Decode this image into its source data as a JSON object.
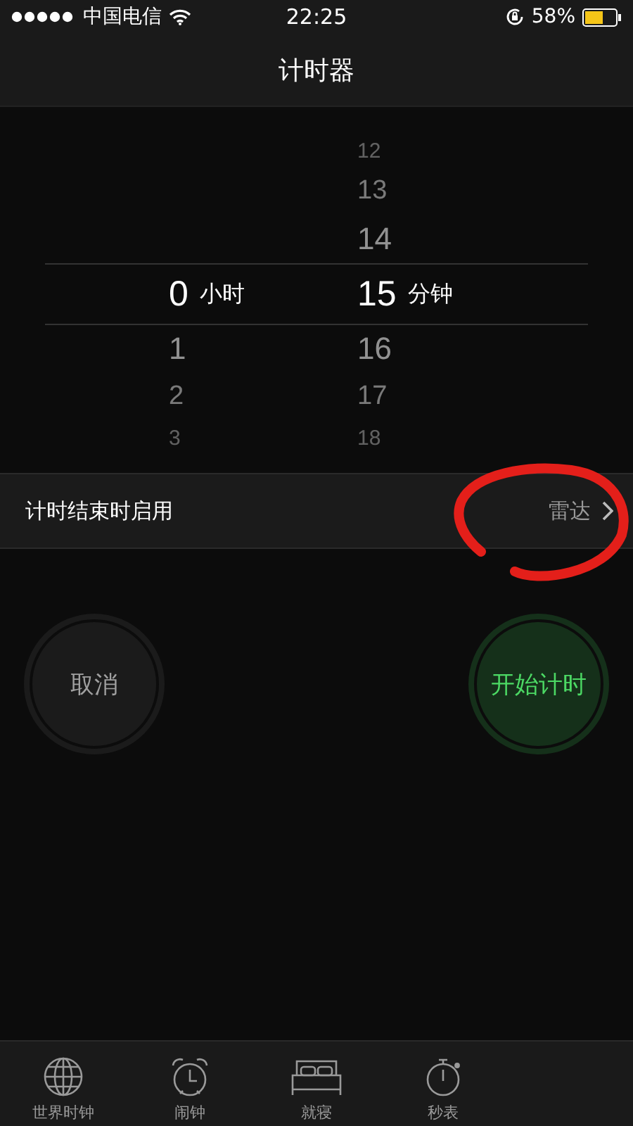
{
  "status_bar": {
    "carrier": "中国电信",
    "time": "22:25",
    "battery": "58%"
  },
  "nav": {
    "title": "计时器"
  },
  "picker": {
    "columns": [
      {
        "selected": "0",
        "below": [
          "1",
          "2",
          "3"
        ],
        "unit": "小时"
      },
      {
        "above": [
          "12",
          "13",
          "14"
        ],
        "selected": "15",
        "below": [
          "16",
          "17",
          "18"
        ],
        "unit": "分钟"
      }
    ]
  },
  "setting": {
    "label": "计时结束时启用",
    "value": "雷达"
  },
  "buttons": [
    {
      "label": "取消",
      "kind": "cancel"
    },
    {
      "label": "开始计时",
      "kind": "start"
    }
  ],
  "annotation": {
    "kind": "circle"
  },
  "tabs": [
    {
      "label": "世界时钟",
      "kind": "globe",
      "selected": false
    },
    {
      "label": "闹钟",
      "kind": "alarm",
      "selected": false
    },
    {
      "label": "就寝",
      "kind": "bed",
      "selected": false
    },
    {
      "label": "秒表",
      "kind": "stopwatch",
      "selected": false
    }
  ]
}
